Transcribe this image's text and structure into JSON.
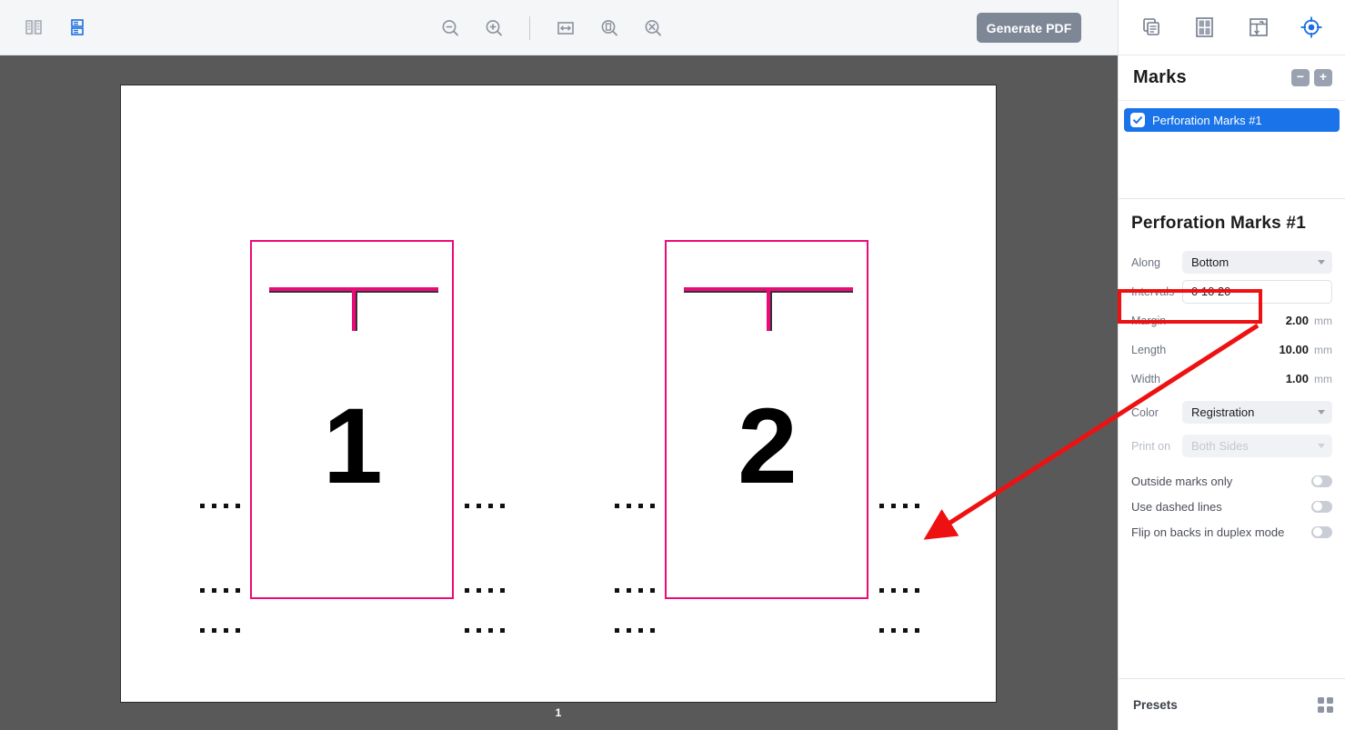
{
  "toolbar": {
    "view_icons": [
      {
        "name": "two-column-view-icon",
        "active": false
      },
      {
        "name": "stacked-rows-view-icon",
        "active": true
      }
    ],
    "zoom_out_label": "Zoom Out",
    "zoom_in_label": "Zoom In",
    "fit_width_label": "Fit Width",
    "fit_page_label": "Fit Page",
    "actual_size_label": "Actual Size",
    "generate_pdf_label": "Generate PDF"
  },
  "canvas": {
    "page_number": "1",
    "pages": [
      {
        "number": "1"
      },
      {
        "number": "2"
      }
    ],
    "mark_color_hex": "#ec0a79",
    "sheet_background_hex": "#ffffff",
    "canvas_background_hex": "#595959"
  },
  "panel": {
    "tabs": [
      {
        "name": "documents-tab",
        "label": "Documents",
        "active": false
      },
      {
        "name": "imposition-tab",
        "label": "Imposition",
        "active": false
      },
      {
        "name": "layout-tab",
        "label": "Layout",
        "active": false
      },
      {
        "name": "marks-tab",
        "label": "Marks",
        "active": true
      }
    ],
    "marks_header": {
      "title": "Marks",
      "remove_label": "−",
      "add_label": "+"
    },
    "marks_list": [
      {
        "label": "Perforation Marks #1",
        "checked": true,
        "selected": true
      }
    ],
    "detail": {
      "title": "Perforation Marks #1",
      "fields": [
        {
          "label": "Along",
          "type": "select",
          "value": "Bottom",
          "disabled": false
        },
        {
          "label": "Intervals",
          "type": "input",
          "value": "0 10 20",
          "disabled": false
        },
        {
          "label": "Margin",
          "type": "value",
          "value": "2.00",
          "unit": "mm"
        },
        {
          "label": "Length",
          "type": "value",
          "value": "10.00",
          "unit": "mm"
        },
        {
          "label": "Width",
          "type": "value",
          "value": "1.00",
          "unit": "mm"
        },
        {
          "label": "Color",
          "type": "select",
          "value": "Registration",
          "disabled": false
        },
        {
          "label": "Print on",
          "type": "select",
          "value": "Both Sides",
          "disabled": true
        }
      ],
      "toggles": [
        {
          "label": "Outside marks only",
          "on": false
        },
        {
          "label": "Use dashed lines",
          "on": false
        },
        {
          "label": "Flip on backs in duplex mode",
          "on": false
        }
      ]
    },
    "presets": {
      "label": "Presets"
    },
    "accent_hex": "#1a73e8"
  },
  "annotation": {
    "highlight_color_hex": "#ee1111",
    "target_field": "Intervals",
    "target_value": "0 10 20"
  }
}
